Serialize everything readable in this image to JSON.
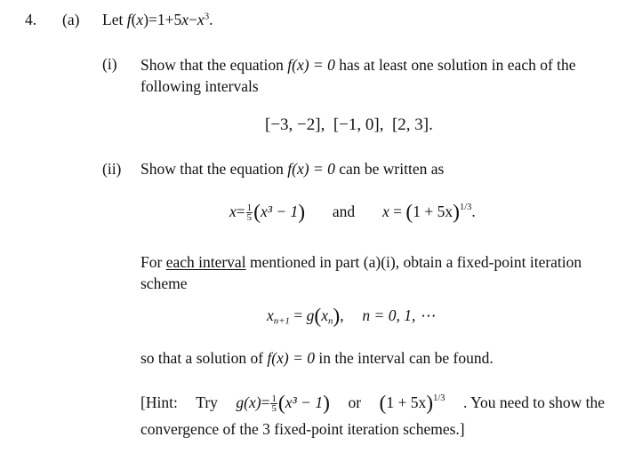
{
  "question": {
    "number": "4.",
    "part_a": {
      "label": "(a)",
      "intro": "Let",
      "function_def": {
        "lhs": "f",
        "arg": "x",
        "rhs_prefix": "1+5",
        "rhs_var": "x",
        "rhs_minus": "−",
        "rhs_cubed_var": "x",
        "exponent": "3",
        "end": "."
      }
    },
    "subpart_i": {
      "label": "(i)",
      "text_before": "Show that the equation",
      "equation": "f(x) = 0",
      "text_after": "has at least one solution in each of the",
      "line2": "following intervals",
      "intervals": [
        "[−3, −2]",
        "[−1, 0]",
        "[2, 3]"
      ],
      "intervals_end": "."
    },
    "subpart_ii": {
      "label": "(ii)",
      "text_before": "Show that the equation",
      "equation": "f(x) = 0",
      "text_after": "can be written as",
      "form1": {
        "lhs": "x",
        "frac_num": "1",
        "frac_den": "5",
        "inner": "x³ − 1"
      },
      "connector": "and",
      "form2": {
        "lhs": "x",
        "inner": "1 + 5x",
        "exponent": "1/3"
      },
      "end": ".",
      "instruction_prefix": "For",
      "instruction_underlined": "each interval",
      "instruction_rest": "mentioned in part (a)(i), obtain a fixed-point iteration",
      "instruction_line2": "scheme",
      "scheme": {
        "lhs": "x",
        "lhs_sub": "n+1",
        "g": "g",
        "arg": "x",
        "arg_sub": "n",
        "n_range": "n = 0, 1, ⋯"
      },
      "purpose_before": "so that a solution of",
      "purpose_equation": "f(x) = 0",
      "purpose_after": "in the interval can be found.",
      "hint": {
        "open": "[Hint:",
        "try": "Try",
        "g_def": "g(x)",
        "option1_num": "1",
        "option1_den": "5",
        "option1_inner": "x³ − 1",
        "or": "or",
        "option2_inner": "1 + 5x",
        "option2_exponent": "1/3",
        "after": ". You need to show the",
        "line2": "convergence of the 3 fixed-point iteration schemes.]"
      }
    }
  }
}
